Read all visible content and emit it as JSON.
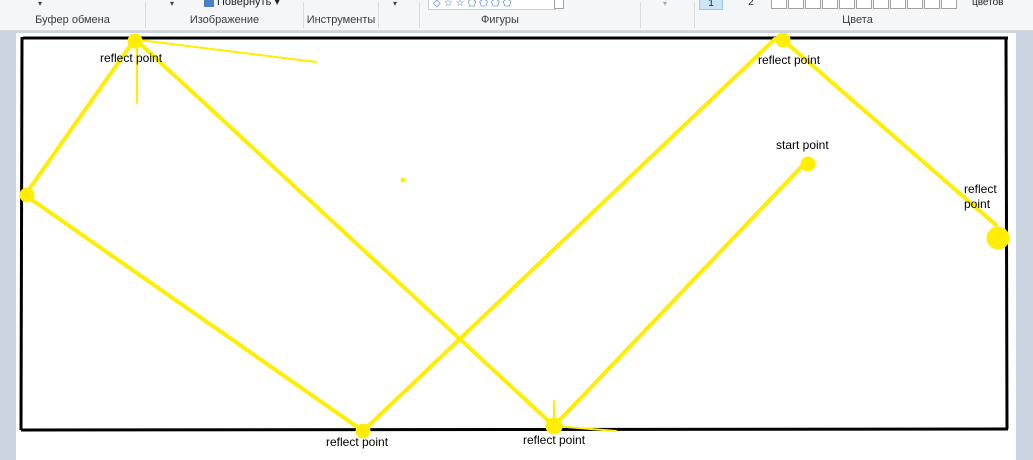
{
  "ribbon": {
    "groups": {
      "clipboard": "Буфер обмена",
      "image": "Изображение",
      "tools": "Инструменты",
      "shapes": "Фигуры",
      "colors": "Цвета"
    },
    "rotate_label": "Повернуть",
    "size_options": [
      "1",
      "2"
    ],
    "colors_more_label": "цветов"
  },
  "drawing": {
    "stroke_color": "#ffee00",
    "frame_color": "#000000",
    "labels": {
      "top_left": "reflect point",
      "top_right": "reflect point",
      "start": "start point",
      "right": [
        "reflect",
        "point"
      ],
      "bottom_left": "reflect point",
      "bottom_right": "reflect point"
    }
  }
}
